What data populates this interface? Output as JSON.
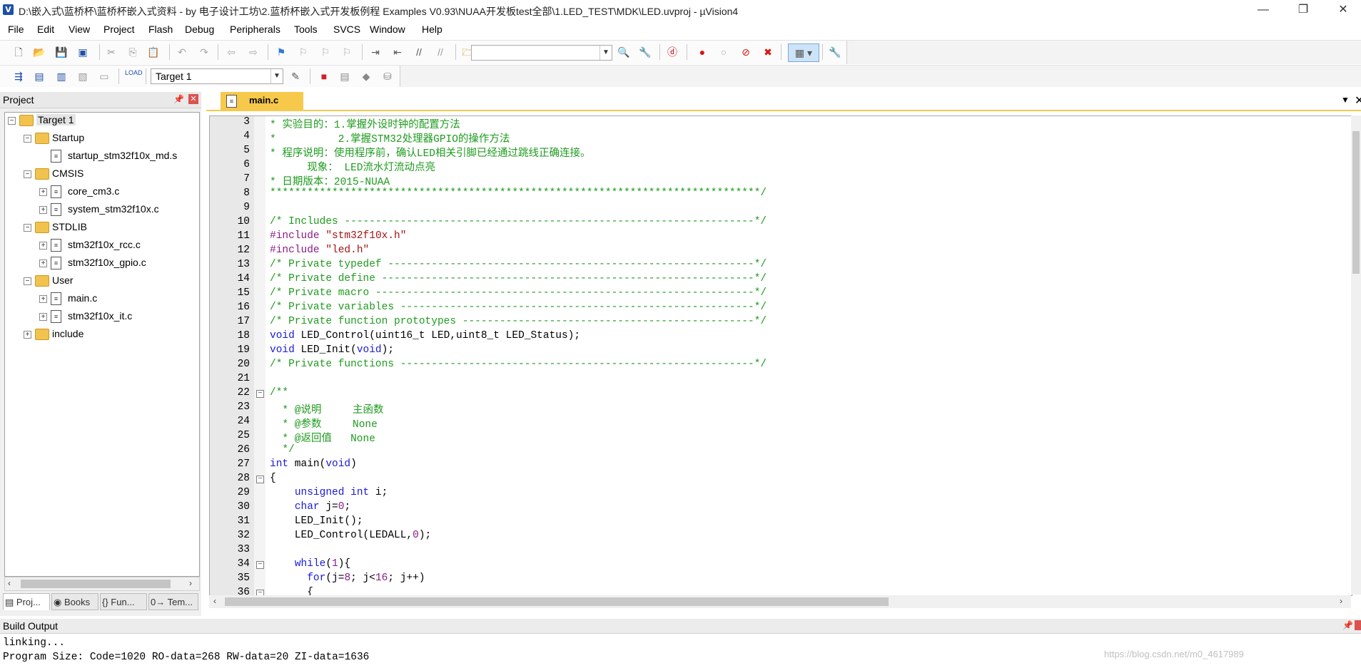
{
  "window": {
    "title": "D:\\嵌入式\\蓝桥杯\\蓝桥杯嵌入式资料 - by 电子设计工坊\\2.蓝桥杯嵌入式开发板例程 Examples V0.93\\NUAA开发板test全部\\1.LED_TEST\\MDK\\LED.uvproj - µVision4",
    "app_icon": "V",
    "minimize": "—",
    "restore": "❐",
    "close": "✕"
  },
  "menu": [
    "File",
    "Edit",
    "View",
    "Project",
    "Flash",
    "Debug",
    "Peripherals",
    "Tools",
    "SVCS",
    "Window",
    "Help"
  ],
  "toolbar2": {
    "target_label": "Target 1"
  },
  "project_panel": {
    "title": "Project",
    "pin": "ᵖ",
    "close": "✕",
    "tree": [
      {
        "label": "Target 1",
        "depth": 0,
        "type": "target",
        "expander": "−"
      },
      {
        "label": "Startup",
        "depth": 1,
        "type": "folder",
        "expander": "−"
      },
      {
        "label": "startup_stm32f10x_md.s",
        "depth": 2,
        "type": "file",
        "expander": ""
      },
      {
        "label": "CMSIS",
        "depth": 1,
        "type": "folder",
        "expander": "−"
      },
      {
        "label": "core_cm3.c",
        "depth": 2,
        "type": "file",
        "expander": "+"
      },
      {
        "label": "system_stm32f10x.c",
        "depth": 2,
        "type": "file",
        "expander": "+"
      },
      {
        "label": "STDLIB",
        "depth": 1,
        "type": "folder",
        "expander": "−"
      },
      {
        "label": "stm32f10x_rcc.c",
        "depth": 2,
        "type": "file",
        "expander": "+"
      },
      {
        "label": "stm32f10x_gpio.c",
        "depth": 2,
        "type": "file",
        "expander": "+"
      },
      {
        "label": "User",
        "depth": 1,
        "type": "folder",
        "expander": "−"
      },
      {
        "label": "main.c",
        "depth": 2,
        "type": "file",
        "expander": "+"
      },
      {
        "label": "stm32f10x_it.c",
        "depth": 2,
        "type": "file",
        "expander": "+"
      },
      {
        "label": "include",
        "depth": 1,
        "type": "folder",
        "expander": "+"
      }
    ],
    "tabs": [
      "Proj...",
      "Books",
      "{} Fun...",
      "0→ Tem..."
    ]
  },
  "editor": {
    "tab_label": "main.c",
    "lines": [
      {
        "n": "3",
        "fold": "",
        "segs": [
          {
            "t": "* 实验目的：1.掌握外设时钟的配置方法",
            "c": "green"
          }
        ]
      },
      {
        "n": "4",
        "fold": "",
        "segs": [
          {
            "t": "*          2.掌握STM32处理器GPIO的操作方法",
            "c": "green"
          }
        ]
      },
      {
        "n": "5",
        "fold": "",
        "segs": [
          {
            "t": "* 程序说明：使用程序前，确认LED相关引脚已经通过跳线正确连接。",
            "c": "green"
          }
        ]
      },
      {
        "n": "6",
        "fold": "",
        "segs": [
          {
            "t": "      现象： LED流水灯流动点亮",
            "c": "green"
          }
        ]
      },
      {
        "n": "7",
        "fold": "",
        "segs": [
          {
            "t": "* 日期版本：2015-NUAA",
            "c": "green"
          }
        ]
      },
      {
        "n": "8",
        "fold": "",
        "segs": [
          {
            "t": "*******************************************************************************/",
            "c": "green"
          }
        ]
      },
      {
        "n": "9",
        "fold": "",
        "segs": [
          {
            "t": "",
            "c": ""
          }
        ]
      },
      {
        "n": "10",
        "fold": "",
        "segs": [
          {
            "t": "/* Includes ------------------------------------------------------------------*/",
            "c": "green"
          }
        ]
      },
      {
        "n": "11",
        "fold": "",
        "segs": [
          {
            "t": "#include ",
            "c": "purple"
          },
          {
            "t": "\"stm32f10x.h\"",
            "c": "red"
          }
        ]
      },
      {
        "n": "12",
        "fold": "",
        "segs": [
          {
            "t": "#include ",
            "c": "purple"
          },
          {
            "t": "\"led.h\"",
            "c": "red"
          }
        ]
      },
      {
        "n": "13",
        "fold": "",
        "segs": [
          {
            "t": "/* Private typedef -----------------------------------------------------------*/",
            "c": "green"
          }
        ]
      },
      {
        "n": "14",
        "fold": "",
        "segs": [
          {
            "t": "/* Private define ------------------------------------------------------------*/",
            "c": "green"
          }
        ]
      },
      {
        "n": "15",
        "fold": "",
        "segs": [
          {
            "t": "/* Private macro -------------------------------------------------------------*/",
            "c": "green"
          }
        ]
      },
      {
        "n": "16",
        "fold": "",
        "segs": [
          {
            "t": "/* Private variables ---------------------------------------------------------*/",
            "c": "green"
          }
        ]
      },
      {
        "n": "17",
        "fold": "",
        "segs": [
          {
            "t": "/* Private function prototypes -----------------------------------------------*/",
            "c": "green"
          }
        ]
      },
      {
        "n": "18",
        "fold": "",
        "segs": [
          {
            "t": "void",
            "c": "blue"
          },
          {
            "t": " LED_Control(uint16_t LED,uint8_t LED_Status);",
            "c": ""
          }
        ]
      },
      {
        "n": "19",
        "fold": "",
        "segs": [
          {
            "t": "void",
            "c": "blue"
          },
          {
            "t": " LED_Init(",
            "c": ""
          },
          {
            "t": "void",
            "c": "blue"
          },
          {
            "t": ");",
            "c": ""
          }
        ]
      },
      {
        "n": "20",
        "fold": "",
        "segs": [
          {
            "t": "/* Private functions ---------------------------------------------------------*/",
            "c": "green"
          }
        ]
      },
      {
        "n": "21",
        "fold": "",
        "segs": [
          {
            "t": "",
            "c": ""
          }
        ]
      },
      {
        "n": "22",
        "fold": "−",
        "segs": [
          {
            "t": "/**",
            "c": "green"
          }
        ]
      },
      {
        "n": "23",
        "fold": "",
        "segs": [
          {
            "t": "  * @说明     主函数",
            "c": "green"
          }
        ]
      },
      {
        "n": "24",
        "fold": "",
        "segs": [
          {
            "t": "  * @参数     None",
            "c": "green"
          }
        ]
      },
      {
        "n": "25",
        "fold": "",
        "segs": [
          {
            "t": "  * @返回值   None",
            "c": "green"
          }
        ]
      },
      {
        "n": "26",
        "fold": "",
        "segs": [
          {
            "t": "  */",
            "c": "green"
          }
        ]
      },
      {
        "n": "27",
        "fold": "",
        "segs": [
          {
            "t": "int",
            "c": "blue"
          },
          {
            "t": " main(",
            "c": ""
          },
          {
            "t": "void",
            "c": "blue"
          },
          {
            "t": ")",
            "c": ""
          }
        ]
      },
      {
        "n": "28",
        "fold": "−",
        "segs": [
          {
            "t": "{",
            "c": ""
          }
        ]
      },
      {
        "n": "29",
        "fold": "",
        "segs": [
          {
            "t": "    ",
            "c": ""
          },
          {
            "t": "unsigned int",
            "c": "blue"
          },
          {
            "t": " i;",
            "c": ""
          }
        ]
      },
      {
        "n": "30",
        "fold": "",
        "segs": [
          {
            "t": "    ",
            "c": ""
          },
          {
            "t": "char",
            "c": "blue"
          },
          {
            "t": " j=",
            "c": ""
          },
          {
            "t": "0",
            "c": "purple"
          },
          {
            "t": ";",
            "c": ""
          }
        ]
      },
      {
        "n": "31",
        "fold": "",
        "segs": [
          {
            "t": "    LED_Init();",
            "c": ""
          }
        ]
      },
      {
        "n": "32",
        "fold": "",
        "segs": [
          {
            "t": "    LED_Control(LEDALL,",
            "c": ""
          },
          {
            "t": "0",
            "c": "purple"
          },
          {
            "t": ");",
            "c": ""
          }
        ]
      },
      {
        "n": "33",
        "fold": "",
        "segs": [
          {
            "t": "",
            "c": ""
          }
        ]
      },
      {
        "n": "34",
        "fold": "−",
        "segs": [
          {
            "t": "    ",
            "c": ""
          },
          {
            "t": "while",
            "c": "blue"
          },
          {
            "t": "(",
            "c": ""
          },
          {
            "t": "1",
            "c": "purple"
          },
          {
            "t": "){",
            "c": ""
          }
        ]
      },
      {
        "n": "35",
        "fold": "",
        "segs": [
          {
            "t": "      ",
            "c": ""
          },
          {
            "t": "for",
            "c": "blue"
          },
          {
            "t": "(j=",
            "c": ""
          },
          {
            "t": "8",
            "c": "purple"
          },
          {
            "t": "; j<",
            "c": ""
          },
          {
            "t": "16",
            "c": "purple"
          },
          {
            "t": "; j++)",
            "c": ""
          }
        ]
      },
      {
        "n": "36",
        "fold": "−",
        "segs": [
          {
            "t": "      {",
            "c": ""
          }
        ]
      }
    ]
  },
  "build_output": {
    "title": "Build Output",
    "lines": [
      "linking...",
      "Program Size: Code=1020 RO-data=268 RW-data=20 ZI-data=1636"
    ]
  },
  "watermark": "https://blog.csdn.net/m0_4617989",
  "colors": {
    "green": "#1f9b1f",
    "blue": "#1a1ad6",
    "purple": "#8b1a8b",
    "red": "#a31515",
    "tab_active": "#f7c94b"
  }
}
